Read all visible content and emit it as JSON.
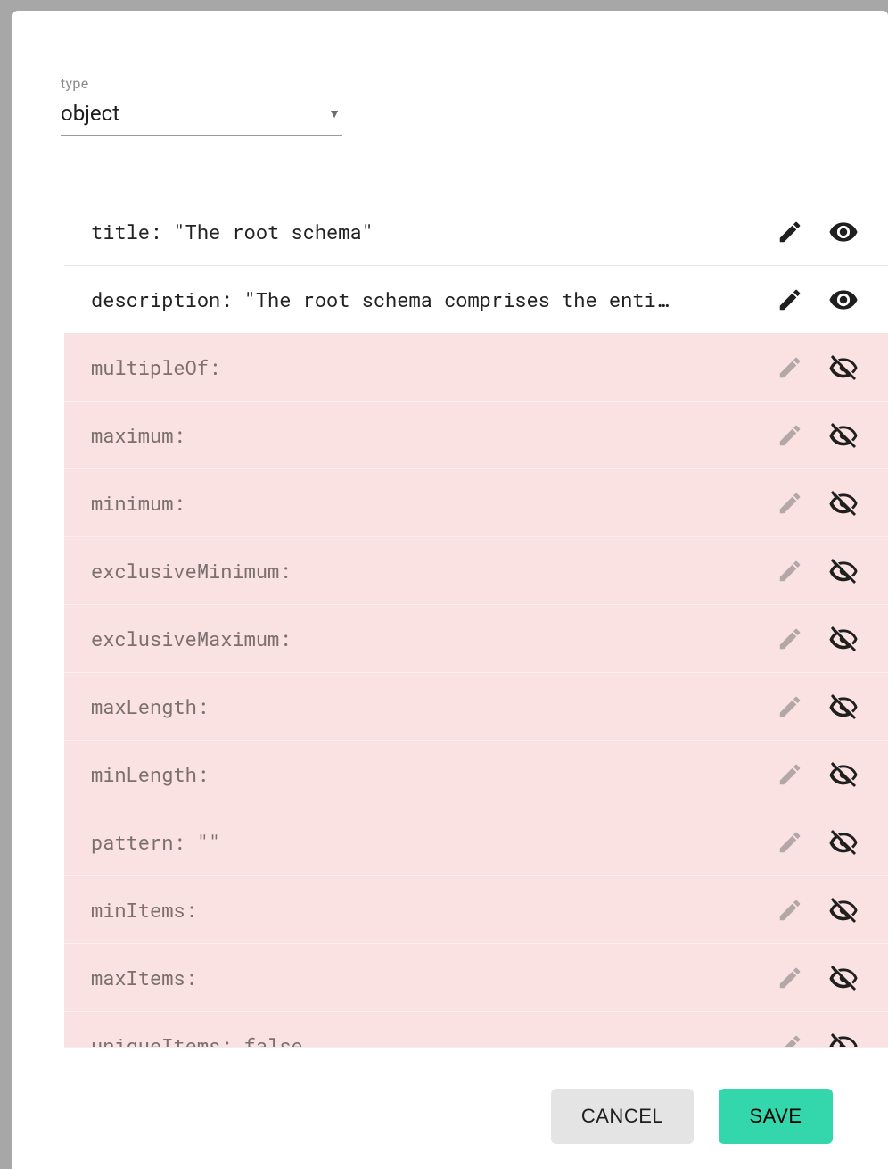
{
  "type_field": {
    "label": "type",
    "value": "object"
  },
  "properties": [
    {
      "key": "title",
      "value": "\"The root schema\"",
      "active": true
    },
    {
      "key": "description",
      "value": "\"The root schema comprises the enti…",
      "active": true
    },
    {
      "key": "multipleOf",
      "value": "",
      "active": false
    },
    {
      "key": "maximum",
      "value": "",
      "active": false
    },
    {
      "key": "minimum",
      "value": "",
      "active": false
    },
    {
      "key": "exclusiveMinimum",
      "value": "",
      "active": false
    },
    {
      "key": "exclusiveMaximum",
      "value": "",
      "active": false
    },
    {
      "key": "maxLength",
      "value": "",
      "active": false
    },
    {
      "key": "minLength",
      "value": "",
      "active": false
    },
    {
      "key": "pattern",
      "value": "\"\"",
      "active": false
    },
    {
      "key": "minItems",
      "value": "",
      "active": false
    },
    {
      "key": "maxItems",
      "value": "",
      "active": false
    },
    {
      "key": "uniqueItems",
      "value": "false",
      "active": false
    }
  ],
  "buttons": {
    "cancel": "CANCEL",
    "save": "SAVE"
  }
}
